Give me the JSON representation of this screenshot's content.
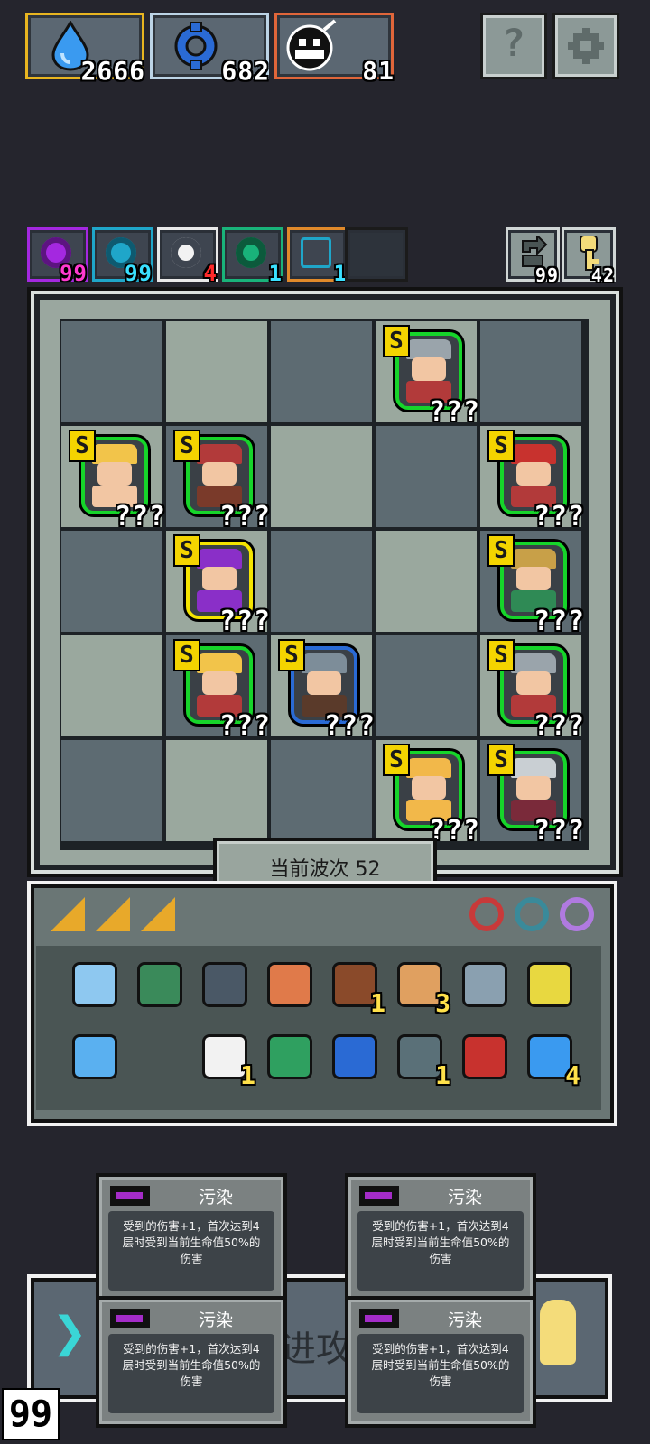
{
  "currencies": [
    {
      "icon": "water-drop-icon",
      "value": "2666",
      "border": "#e8b520"
    },
    {
      "icon": "blue-gear-icon",
      "value": "682",
      "border": "#bcd4e6"
    },
    {
      "icon": "skull-bomb-icon",
      "value": "81",
      "border": "#e0663a"
    }
  ],
  "top_buttons": {
    "help_label": "?",
    "settings_icon": "gear-icon"
  },
  "status_effects": [
    {
      "icon": "purple-swirl-icon",
      "count": "99",
      "color": "#a428e0",
      "count_color": "#ff3ad0"
    },
    {
      "icon": "cyan-swirl-icon",
      "count": "99",
      "color": "#1fa6c9",
      "count_color": "#3ae0ff"
    },
    {
      "icon": "light-icon",
      "count": "4",
      "color": "#e8e8e8",
      "count_color": "#ff2a2a"
    },
    {
      "icon": "green-eye-icon",
      "count": "1",
      "color": "#19b37a",
      "count_color": "#3ae0ff"
    },
    {
      "icon": "lightning-icon",
      "count": "1",
      "color": "#e0892a",
      "count_color": "#3ae0ff"
    }
  ],
  "counters": [
    {
      "icon": "refresh-arrow-icon",
      "value": "99"
    },
    {
      "icon": "key-icon",
      "value": "42"
    }
  ],
  "board": {
    "units": [
      {
        "row": 0,
        "col": 3,
        "rank": "S",
        "hp": "???",
        "hat": "#9aa4ab",
        "torso": "#b23a3a",
        "outline": "#16d42a"
      },
      {
        "row": 1,
        "col": 0,
        "rank": "S",
        "hp": "???",
        "hat": "#f2c44a",
        "torso": "#f2c6a3",
        "outline": "#16d42a"
      },
      {
        "row": 1,
        "col": 1,
        "rank": "S",
        "hp": "???",
        "hat": "#b23a3a",
        "torso": "#7a3a2a",
        "outline": "#16d42a"
      },
      {
        "row": 1,
        "col": 4,
        "rank": "S",
        "hp": "???",
        "hat": "#c8322e",
        "torso": "#b23a3a",
        "outline": "#16d42a"
      },
      {
        "row": 2,
        "col": 1,
        "rank": "S",
        "hp": "???",
        "hat": "#8a2fc8",
        "torso": "#8a2fc8",
        "outline": "#f4e400"
      },
      {
        "row": 2,
        "col": 4,
        "rank": "S",
        "hp": "???",
        "hat": "#c8a048",
        "torso": "#2f8a55",
        "outline": "#16d42a"
      },
      {
        "row": 3,
        "col": 1,
        "rank": "S",
        "hp": "???",
        "hat": "#f2c44a",
        "torso": "#b23a3a",
        "outline": "#16d42a"
      },
      {
        "row": 3,
        "col": 2,
        "rank": "S",
        "hp": "???",
        "hat": "#7d8d99",
        "torso": "#5a3a2a",
        "outline": "#2a6ad4"
      },
      {
        "row": 3,
        "col": 4,
        "rank": "S",
        "hp": "???",
        "hat": "#9aa4ab",
        "torso": "#b23a3a",
        "outline": "#16d42a"
      },
      {
        "row": 4,
        "col": 3,
        "rank": "S",
        "hp": "???",
        "hat": "#f2b84a",
        "torso": "#f2b84a",
        "outline": "#16d42a"
      },
      {
        "row": 4,
        "col": 4,
        "rank": "S",
        "hp": "???",
        "hat": "#c9cfd3",
        "torso": "#7a2a3a",
        "outline": "#16d42a"
      }
    ]
  },
  "wave_label": "当前波次 52",
  "inventory": {
    "tabs": [
      "orange-card-icon",
      "orange-card-icon",
      "orange-card-icon"
    ],
    "rings": [
      {
        "icon": "red-ring-icon",
        "color": "#c83a3a"
      },
      {
        "icon": "teal-ring-icon",
        "color": "#3a8a9a"
      },
      {
        "icon": "purple-ring-icon",
        "color": "#b07ae0"
      }
    ],
    "items": [
      {
        "icon": "mirror-scroll-icon",
        "color": "#8ec8f0",
        "count": ""
      },
      {
        "icon": "green-helmet-icon",
        "color": "#3a8a5a",
        "count": ""
      },
      {
        "icon": "shield-icon",
        "color": "#4a5866",
        "count": ""
      },
      {
        "icon": "tombstone-icon",
        "color": "#e07a4a",
        "count": ""
      },
      {
        "icon": "book-icon",
        "color": "#8a4a2a",
        "count": "1"
      },
      {
        "icon": "trophy-scroll-icon",
        "color": "#e0a060",
        "count": "3"
      },
      {
        "icon": "stone-icon",
        "color": "#8aa0b0",
        "count": ""
      },
      {
        "icon": "potion-icon",
        "color": "#e8d840",
        "count": ""
      },
      {
        "icon": "network-icon",
        "color": "#5ab0f0",
        "count": ""
      },
      {
        "icon": "empty-slot",
        "color": "transparent",
        "count": ""
      },
      {
        "icon": "cloud-icon",
        "color": "#f2f2f2",
        "count": "1"
      },
      {
        "icon": "recycle-bin-icon",
        "color": "#2fa060",
        "count": ""
      },
      {
        "icon": "blue-ticket-icon",
        "color": "#2a6ad4",
        "count": ""
      },
      {
        "icon": "gun-icon",
        "color": "#5a7078",
        "count": "1"
      },
      {
        "icon": "maple-leaf-icon",
        "color": "#c8322e",
        "count": ""
      },
      {
        "icon": "water-drop-icon",
        "color": "#3a9af0",
        "count": "4"
      }
    ]
  },
  "bottom_bar": {
    "hint": "进攻",
    "level": "99"
  },
  "tooltips": [
    {
      "title": "污染",
      "desc_line1": "受到的伤害+1，首次达到4",
      "desc_line2": "层时受到当前生命值50%的",
      "desc_line3": "伤害"
    },
    {
      "title": "污染",
      "desc_line1": "受到的伤害+1，首次达到4",
      "desc_line2": "层时受到当前生命值50%的",
      "desc_line3": "伤害"
    },
    {
      "title": "污染",
      "desc_line1": "受到的伤害+1，首次达到4",
      "desc_line2": "层时受到当前生命值50%的",
      "desc_line3": "伤害"
    },
    {
      "title": "污染",
      "desc_line1": "受到的伤害+1，首次达到4",
      "desc_line2": "层时受到当前生命值50%的",
      "desc_line3": "伤害"
    }
  ]
}
